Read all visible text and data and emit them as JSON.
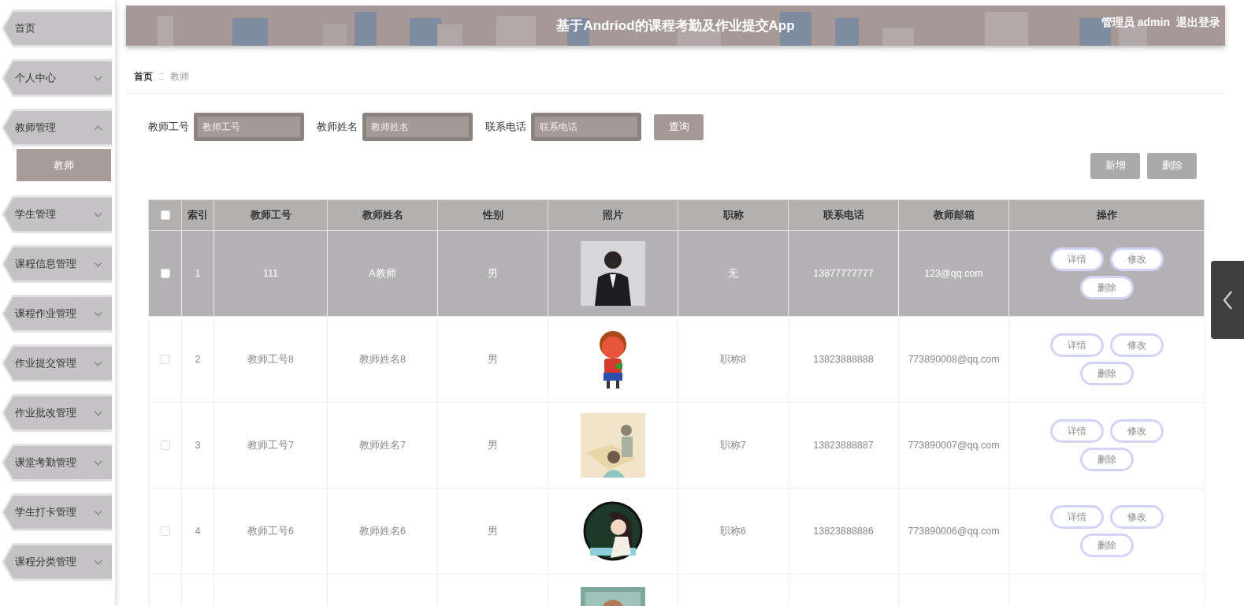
{
  "sidebar": {
    "items": [
      {
        "label": "首页",
        "kind": "link"
      },
      {
        "label": "个人中心",
        "kind": "menu",
        "expanded": false
      },
      {
        "label": "教师管理",
        "kind": "menu",
        "expanded": true,
        "children": [
          {
            "label": "教师",
            "selected": true
          }
        ]
      },
      {
        "label": "学生管理",
        "kind": "menu",
        "expanded": false
      },
      {
        "label": "课程信息管理",
        "kind": "menu",
        "expanded": false
      },
      {
        "label": "课程作业管理",
        "kind": "menu",
        "expanded": false
      },
      {
        "label": "作业提交管理",
        "kind": "menu",
        "expanded": false
      },
      {
        "label": "作业批改管理",
        "kind": "menu",
        "expanded": false
      },
      {
        "label": "课堂考勤管理",
        "kind": "menu",
        "expanded": false
      },
      {
        "label": "学生打卡管理",
        "kind": "menu",
        "expanded": false
      },
      {
        "label": "课程分类管理",
        "kind": "menu",
        "expanded": false
      }
    ]
  },
  "header": {
    "title": "基于Andriod的课程考勤及作业提交App",
    "user": "管理员 admin",
    "logout": "退出登录"
  },
  "breadcrumb": [
    {
      "label": "首页"
    },
    {
      "label": "教师"
    }
  ],
  "search": {
    "fields": [
      {
        "label": "教师工号",
        "placeholder": "教师工号"
      },
      {
        "label": "教师姓名",
        "placeholder": "教师姓名"
      },
      {
        "label": "联系电话",
        "placeholder": "联系电话"
      }
    ],
    "button": "查询"
  },
  "toolbar": [
    "新增",
    "删除"
  ],
  "table": {
    "columns": [
      "索引",
      "教师工号",
      "教师姓名",
      "性别",
      "照片",
      "职称",
      "联系电话",
      "教师邮箱",
      "操作"
    ],
    "header_checked": false,
    "rows": [
      {
        "kind": "full",
        "checked": false,
        "highlighted": true,
        "cells": [
          "1",
          "111",
          "A教师",
          "男"
        ],
        "photo": {
          "kind": "picture"
        },
        "more": [
          "无",
          "13877777777",
          "123@qq.com"
        ],
        "actions": [
          "详情",
          "修改",
          "删除"
        ]
      },
      {
        "kind": "full",
        "checked": false,
        "highlighted": false,
        "cells": [
          "2",
          "教师工号8",
          "教师姓名8",
          "男"
        ],
        "photo": {
          "kind": "picture"
        },
        "more": [
          "职称8",
          "13823888888",
          "773890008@qq.com"
        ],
        "actions": [
          "详情",
          "修改",
          "删除"
        ]
      },
      {
        "kind": "full",
        "checked": false,
        "highlighted": false,
        "cells": [
          "3",
          "教师工号7",
          "教师姓名7",
          "男"
        ],
        "photo": {
          "kind": "picture"
        },
        "more": [
          "职称7",
          "13823888887",
          "773890007@qq.com"
        ],
        "actions": [
          "详情",
          "修改",
          "删除"
        ]
      },
      {
        "kind": "full",
        "checked": false,
        "highlighted": false,
        "cells": [
          "4",
          "教师工号6",
          "教师姓名6",
          "男"
        ],
        "photo": {
          "kind": "picture"
        },
        "more": [
          "职称6",
          "13823888886",
          "773890006@qq.com"
        ],
        "actions": [
          "详情",
          "修改",
          "删除"
        ]
      },
      {
        "kind": "partial",
        "photo": {
          "kind": "picture"
        }
      }
    ]
  }
}
